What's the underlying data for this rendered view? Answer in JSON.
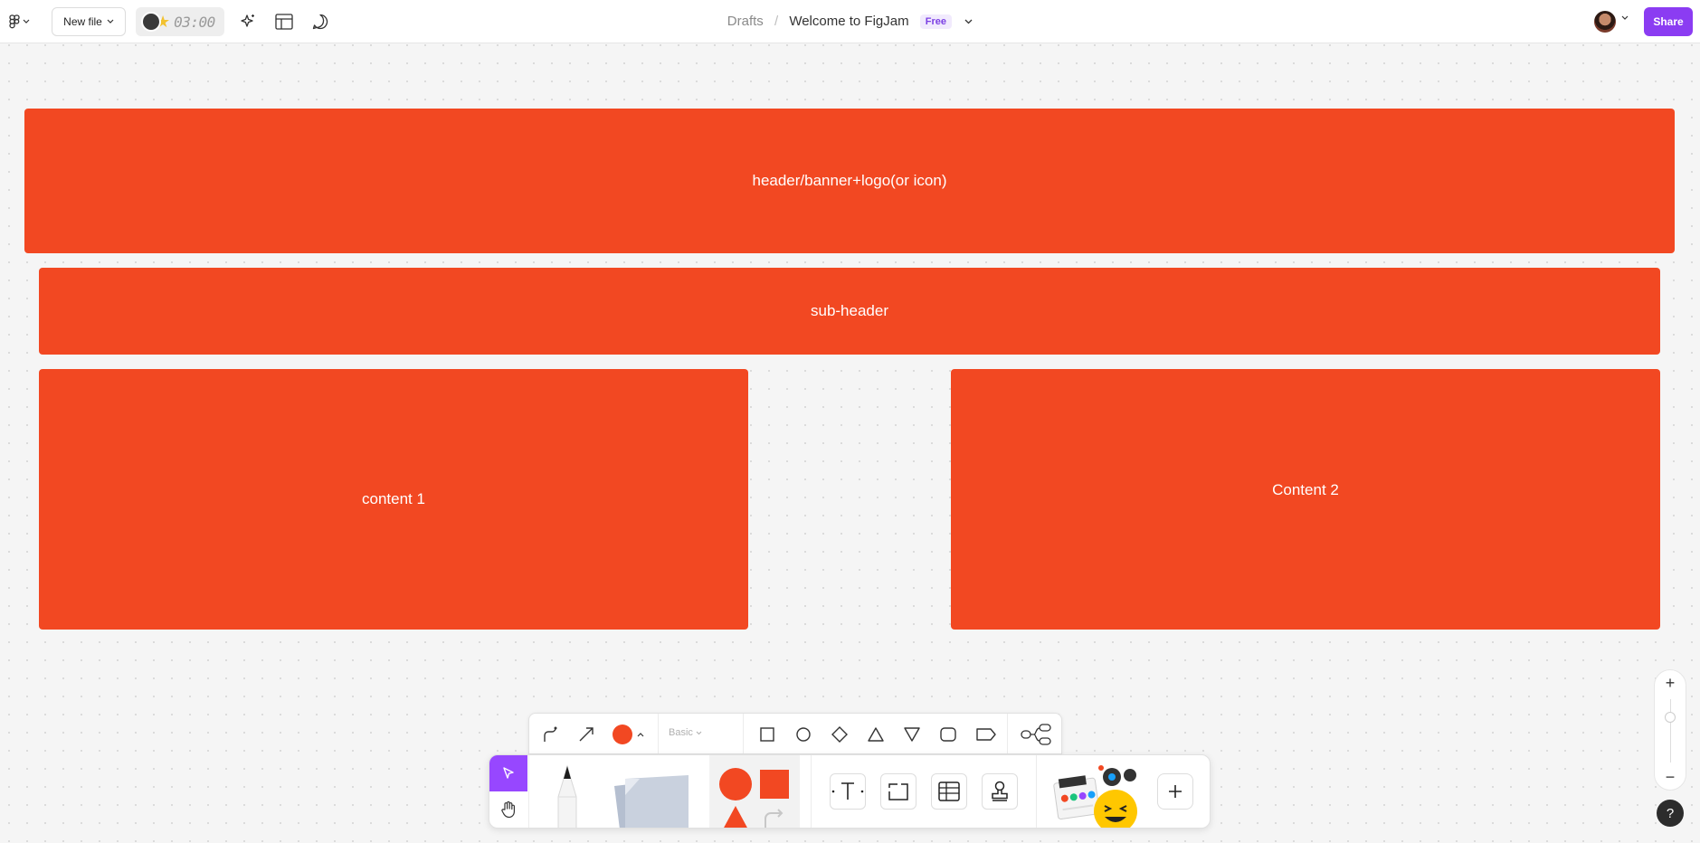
{
  "topbar": {
    "new_file_label": "New file",
    "timer_text": "03:00",
    "breadcrumb": {
      "drafts": "Drafts",
      "separator": "/",
      "title": "Welcome to FigJam",
      "plan_badge": "Free"
    },
    "share_label": "Share"
  },
  "canvas": {
    "header_label": "header/banner+logo(or icon)",
    "subheader_label": "sub-header",
    "content1_label": "content 1",
    "content2_label": "Content 2",
    "shape_color": "#f24822"
  },
  "toolbar": {
    "style_select": "Basic",
    "accent_color": "#9747ff",
    "icons": [
      "connector-icon",
      "arrow-icon",
      "fill-color-icon",
      "square-icon",
      "circle-icon",
      "diamond-icon",
      "triangle-icon",
      "triangle-down-icon",
      "rounded-rect-icon",
      "tag-shape-icon",
      "mindmap-icon",
      "select-icon",
      "hand-icon",
      "pen-icon",
      "sticky-note-icon",
      "shapes-icon",
      "text-icon",
      "section-icon",
      "table-icon",
      "stamp-icon",
      "stickers-icon",
      "plus-icon"
    ]
  },
  "zoom": {
    "plus": "+",
    "minus": "−"
  },
  "help_label": "?"
}
